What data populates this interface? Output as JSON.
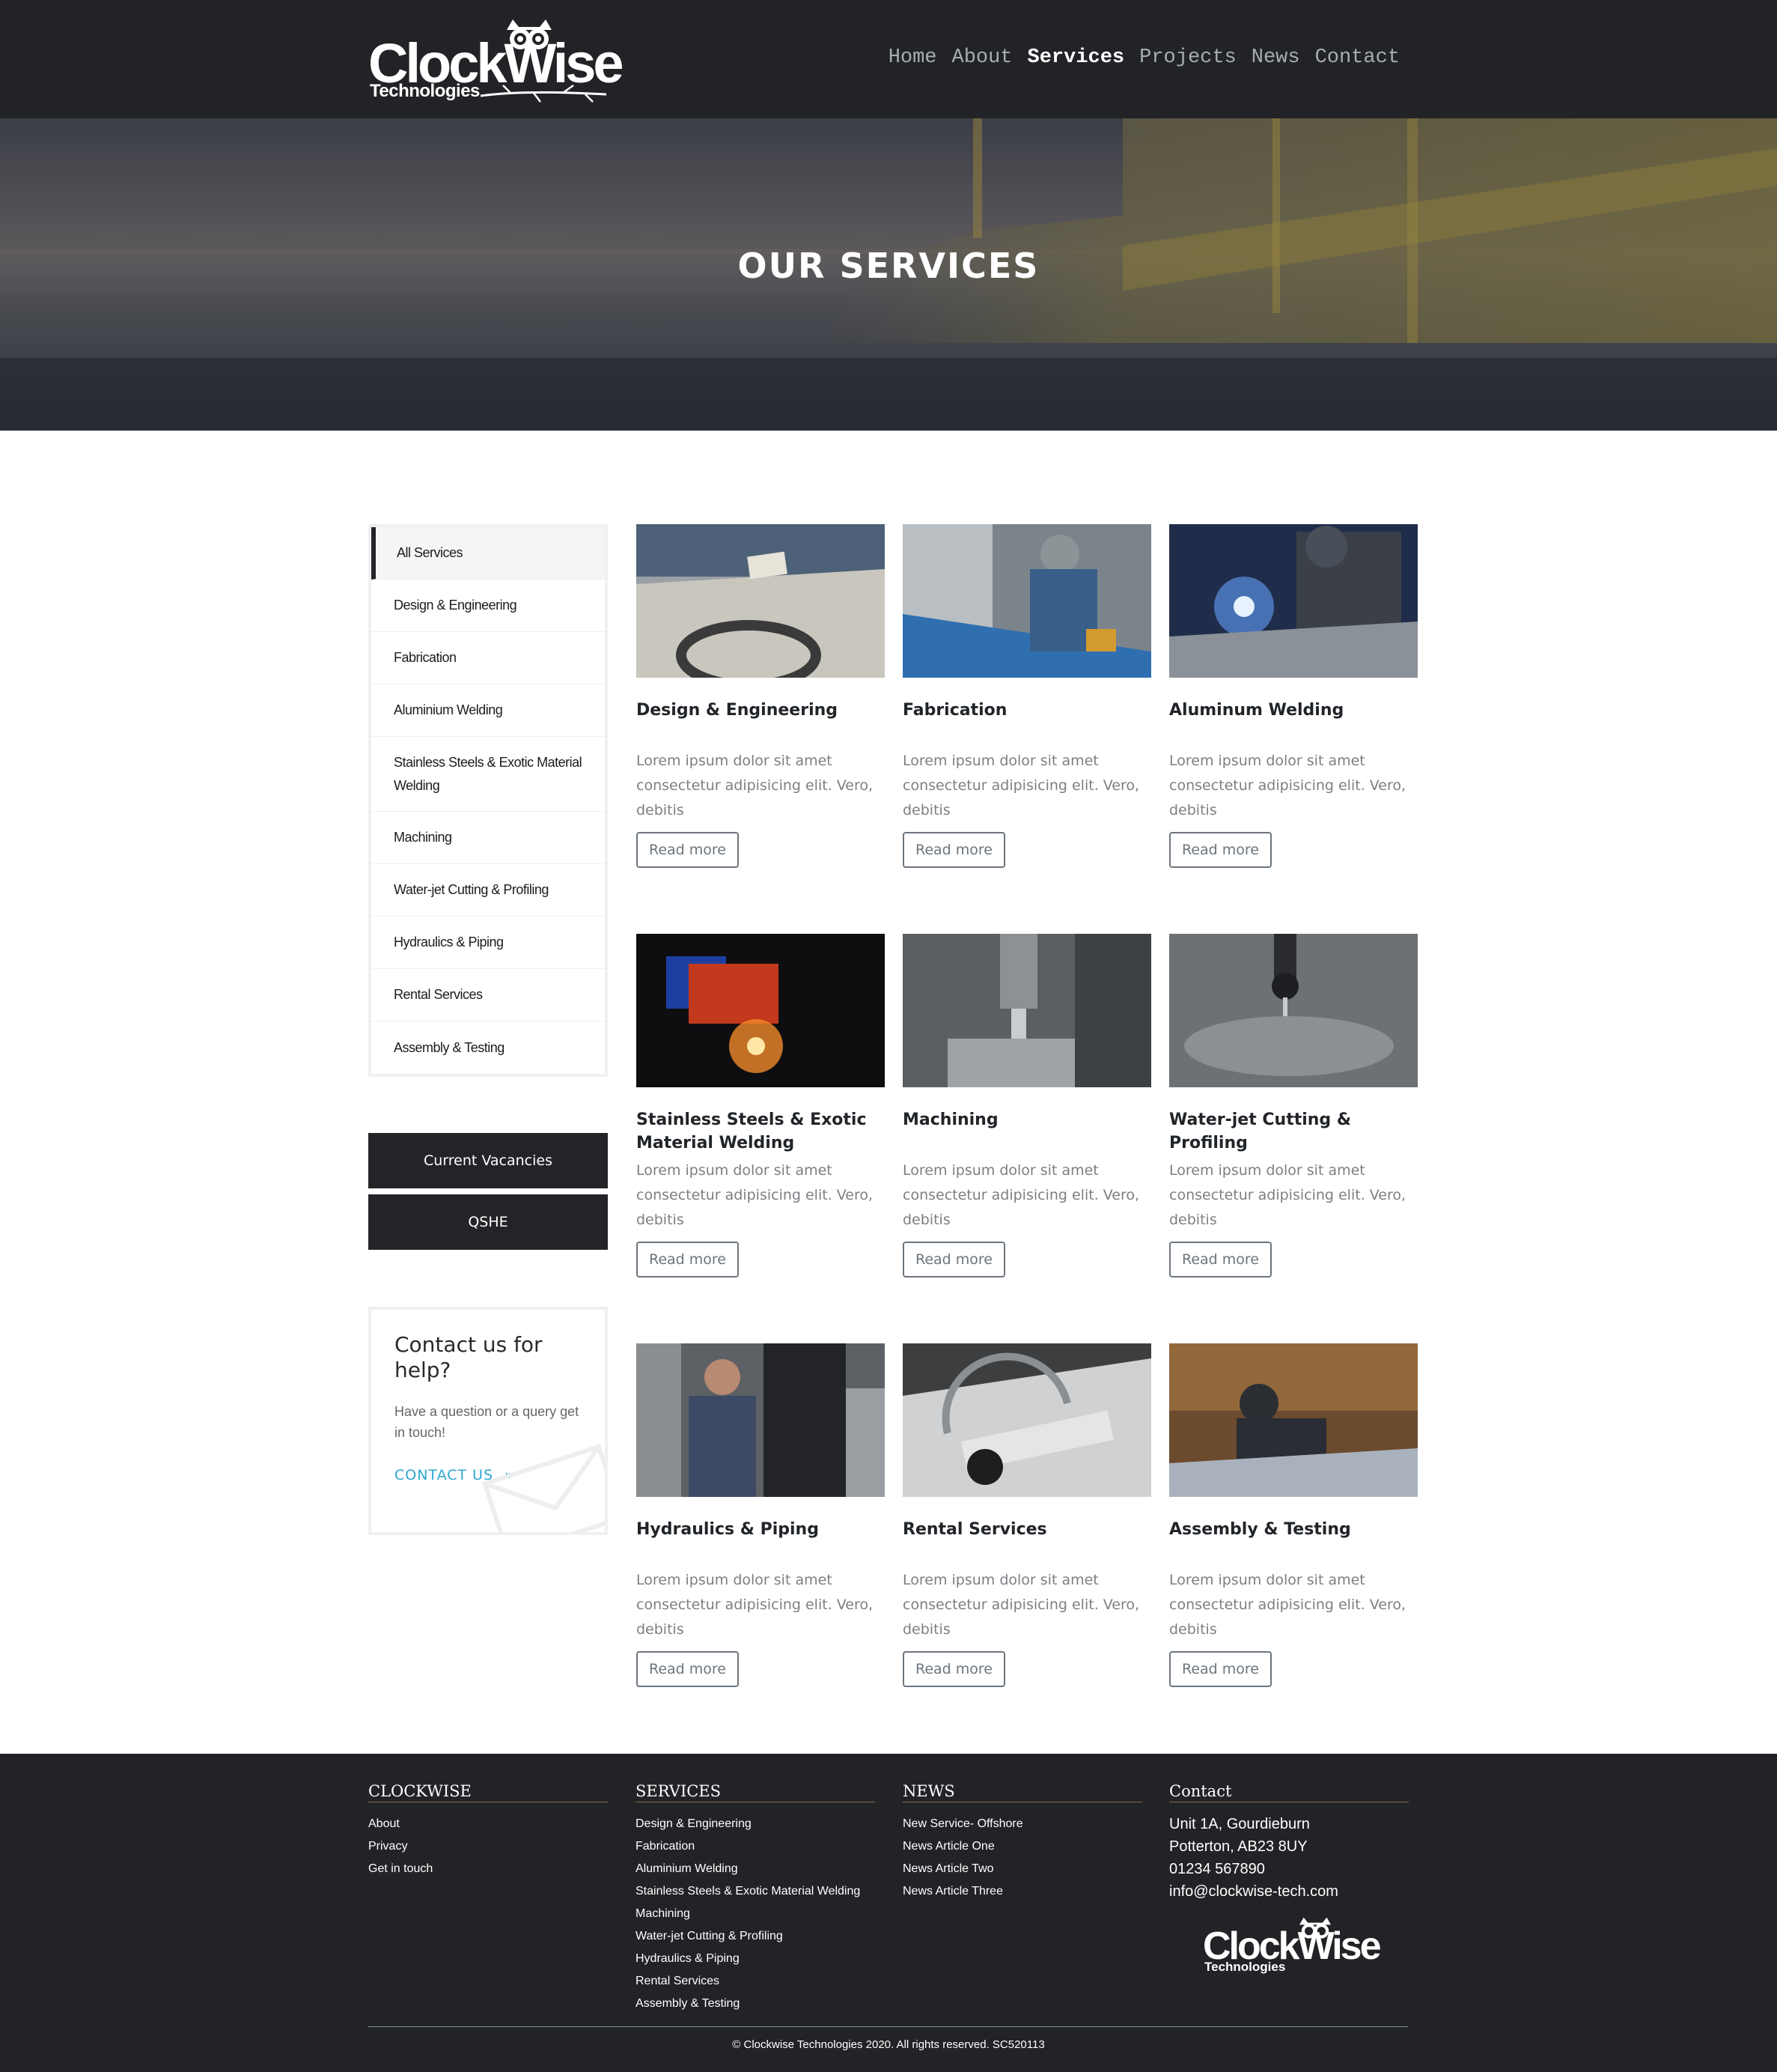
{
  "brand": {
    "logo_word": "ClockWise",
    "logo_sub": "Technologies"
  },
  "nav": {
    "items": [
      "Home",
      "About",
      "Services",
      "Projects",
      "News",
      "Contact"
    ],
    "active": "Services"
  },
  "hero": {
    "title": "OUR SERVICES"
  },
  "sidebar": {
    "items": [
      "All Services",
      "Design & Engineering",
      "Fabrication",
      "Aluminium Welding",
      "Stainless Steels & Exotic Material Welding",
      "Machining",
      "Water-jet Cutting & Profiling",
      "Hydraulics & Piping",
      "Rental Services",
      "Assembly & Testing"
    ],
    "active_index": 0,
    "buttons": [
      "Current Vacancies",
      "QSHE"
    ]
  },
  "contact_card": {
    "heading": "Contact us for help?",
    "text": "Have a question or a query get in touch!",
    "link": "CONTACT US"
  },
  "cards": [
    {
      "title": "Design & Engineering",
      "text": "Lorem ipsum dolor sit amet consectetur adipisicing elit. Vero, debitis",
      "button": "Read more"
    },
    {
      "title": "Fabrication",
      "text": "Lorem ipsum dolor sit amet consectetur adipisicing elit. Vero, debitis",
      "button": "Read more"
    },
    {
      "title": "Aluminum Welding",
      "text": "Lorem ipsum dolor sit amet consectetur adipisicing elit. Vero, debitis",
      "button": "Read more"
    },
    {
      "title": "Stainless Steels & Exotic Material Welding",
      "text": "Lorem ipsum dolor sit amet consectetur adipisicing elit. Vero, debitis",
      "button": "Read more"
    },
    {
      "title": "Machining",
      "text": "Lorem ipsum dolor sit amet consectetur adipisicing elit. Vero, debitis",
      "button": "Read more"
    },
    {
      "title": "Water-jet Cutting & Profiling",
      "text": "Lorem ipsum dolor sit amet consectetur adipisicing elit. Vero, debitis",
      "button": "Read more"
    },
    {
      "title": "Hydraulics & Piping",
      "text": "Lorem ipsum dolor sit amet consectetur adipisicing elit. Vero, debitis",
      "button": "Read more"
    },
    {
      "title": "Rental Services",
      "text": "Lorem ipsum dolor sit amet consectetur adipisicing elit. Vero, debitis",
      "button": "Read more"
    },
    {
      "title": "Assembly & Testing",
      "text": "Lorem ipsum dolor sit amet consectetur adipisicing elit. Vero, debitis",
      "button": "Read more"
    }
  ],
  "footer": {
    "clockwise": {
      "heading": "CLOCKWISE",
      "links": [
        "About",
        "Privacy",
        "Get in touch"
      ]
    },
    "services": {
      "heading": "SERVICES",
      "links": [
        "Design & Engineering",
        "Fabrication",
        "Aluminium Welding",
        "Stainless Steels & Exotic Material Welding",
        "Machining",
        "Water-jet Cutting & Profiling",
        "Hydraulics & Piping",
        "Rental Services",
        "Assembly & Testing"
      ]
    },
    "news": {
      "heading": "NEWS",
      "links": [
        "New Service- Offshore",
        "News Article One",
        "News Article Two",
        "News Article Three"
      ]
    },
    "contact": {
      "heading": "Contact",
      "lines": [
        "Unit 1A, Gourdieburn",
        "Potterton, AB23 8UY",
        "01234 567890",
        "info@clockwise-tech.com"
      ]
    },
    "copyright": "© Clockwise Technologies 2020. All rights reserved. SC520113"
  },
  "colors": {
    "header_bg": "#212326",
    "accent_link": "#2da6cf",
    "dark_button": "#232427",
    "footer_rule": "#8a6e46"
  }
}
